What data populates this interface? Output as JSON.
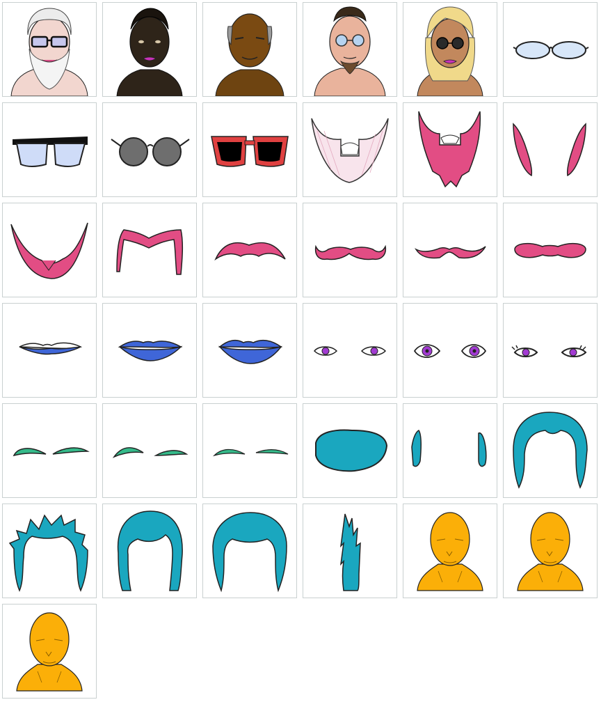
{
  "colors": {
    "pink": "#e24d84",
    "pink_light": "#f7dde6",
    "blue_lips": "#3f66d8",
    "purple_eye": "#a23bd2",
    "green_brow": "#35ba8a",
    "teal_hair": "#1aa7bf",
    "orange_head": "#fbaf08",
    "tile_border": "#c9d0d0"
  },
  "tiles": [
    {
      "icon": "face-white-bearded-avatar-icon"
    },
    {
      "icon": "face-dark-skin-avatar-icon"
    },
    {
      "icon": "face-brown-balding-avatar-icon"
    },
    {
      "icon": "face-light-goatee-avatar-icon"
    },
    {
      "icon": "face-blonde-sunglasses-avatar-icon"
    },
    {
      "icon": "glasses-thin-oval-icon"
    },
    {
      "icon": "glasses-browline-icon"
    },
    {
      "icon": "glasses-round-dark-icon"
    },
    {
      "icon": "glasses-red-square-icon"
    },
    {
      "icon": "beard-full-light-icon"
    },
    {
      "icon": "beard-pink-pointed-icon"
    },
    {
      "icon": "sideburns-pink-icon"
    },
    {
      "icon": "beard-chinstrap-icon"
    },
    {
      "icon": "mustache-horseshoe-icon"
    },
    {
      "icon": "mustache-wide-icon"
    },
    {
      "icon": "mustache-curled-icon"
    },
    {
      "icon": "mustache-thin-icon"
    },
    {
      "icon": "mustache-bushy-icon"
    },
    {
      "icon": "lips-thin-icon"
    },
    {
      "icon": "lips-medium-icon"
    },
    {
      "icon": "lips-full-icon"
    },
    {
      "icon": "eyes-small-icon"
    },
    {
      "icon": "eyes-wide-icon"
    },
    {
      "icon": "eyes-lashes-icon"
    },
    {
      "icon": "eyebrows-thick-icon"
    },
    {
      "icon": "eyebrows-arched-icon"
    },
    {
      "icon": "eyebrows-thin-icon"
    },
    {
      "icon": "hair-bald-cap-icon"
    },
    {
      "icon": "hair-sideburns-icon"
    },
    {
      "icon": "hair-short-widows-peak-icon"
    },
    {
      "icon": "hair-spiky-icon"
    },
    {
      "icon": "hair-bob-bangs-icon"
    },
    {
      "icon": "hair-short-classic-icon"
    },
    {
      "icon": "hair-ponytail-icon"
    },
    {
      "icon": "head-base-1-icon"
    },
    {
      "icon": "head-base-2-icon"
    },
    {
      "icon": "head-base-3-icon"
    }
  ]
}
